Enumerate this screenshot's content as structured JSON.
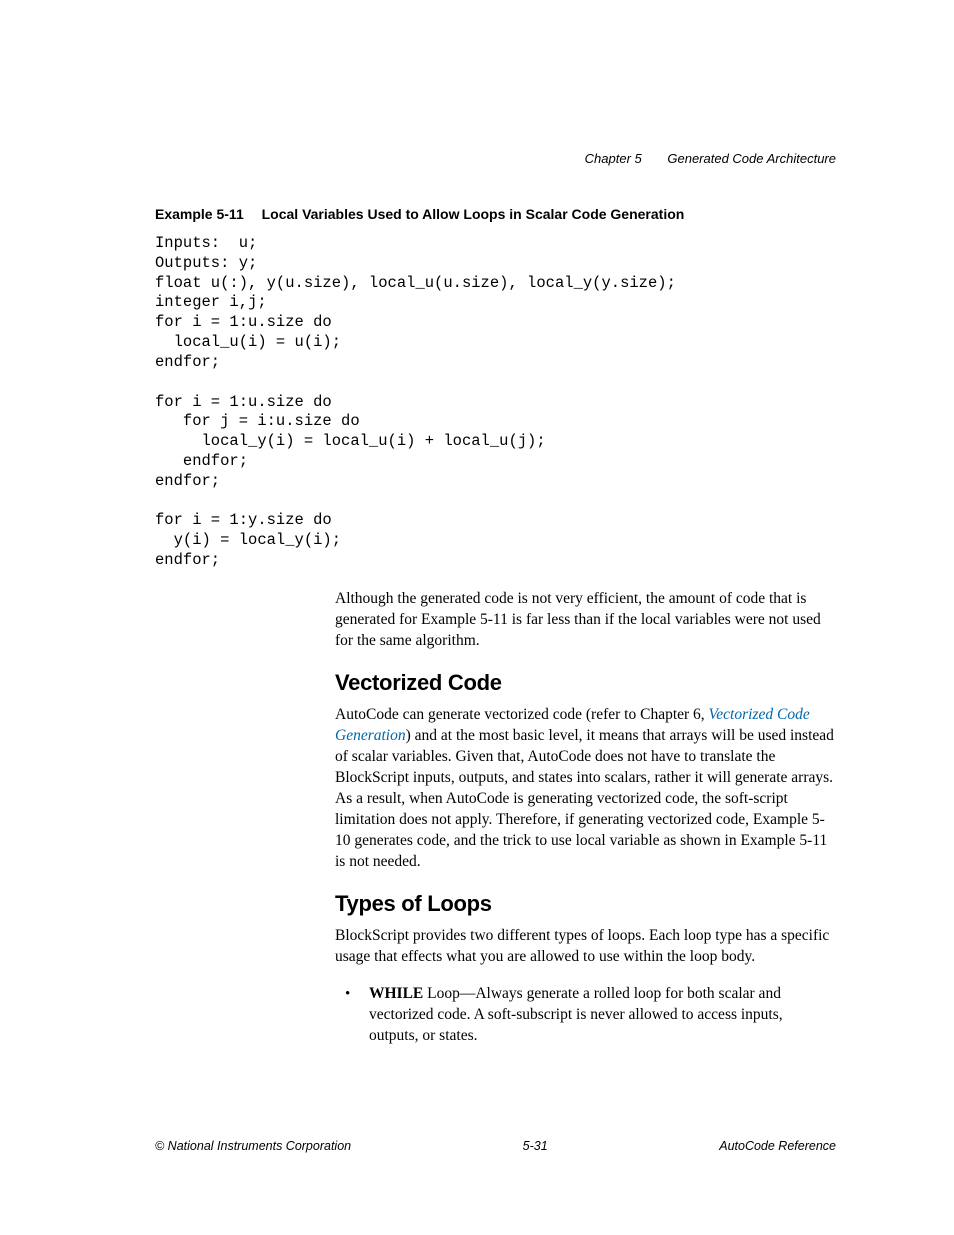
{
  "header": {
    "chapter_label": "Chapter 5",
    "chapter_title": "Generated Code Architecture"
  },
  "example": {
    "label": "Example 5-11",
    "title": "Local Variables Used to Allow Loops in Scalar Code Generation",
    "code": "Inputs:  u;\nOutputs: y;\nfloat u(:), y(u.size), local_u(u.size), local_y(y.size);\ninteger i,j;\nfor i = 1:u.size do\n  local_u(i) = u(i);\nendfor;\n\nfor i = 1:u.size do\n   for j = i:u.size do\n     local_y(i) = local_u(i) + local_u(j);\n   endfor;\nendfor;\n\nfor i = 1:y.size do\n  y(i) = local_y(i);\nendfor;"
  },
  "para_after_example": "Although the generated code is not very efficient, the amount of code that is generated for Example 5-11 is far less than if the local variables were not used for the same algorithm.",
  "sections": {
    "vectorized": {
      "heading": "Vectorized Code",
      "text_before_link": "AutoCode can generate vectorized code (refer to Chapter 6, ",
      "link_text": "Vectorized Code Generation",
      "text_after_link": ") and at the most basic level, it means that arrays will be used instead of scalar variables. Given that, AutoCode does not have to translate the BlockScript inputs, outputs, and states into scalars, rather it will generate arrays. As a result, when AutoCode is generating vectorized code, the soft-script limitation does not apply. Therefore, if generating vectorized code, Example 5-10 generates code, and the trick to use local variable as shown in Example 5-11 is not needed."
    },
    "loops": {
      "heading": "Types of Loops",
      "intro": "BlockScript provides two different types of loops. Each loop type has a specific usage that effects what you are allowed to use within the loop body.",
      "bullet_strong": "WHILE",
      "bullet_rest": " Loop—Always generate a rolled loop for both scalar and vectorized code. A soft-subscript is never allowed to access inputs, outputs, or states."
    }
  },
  "footer": {
    "left": "© National Instruments Corporation",
    "center": "5-31",
    "right": "AutoCode Reference"
  }
}
